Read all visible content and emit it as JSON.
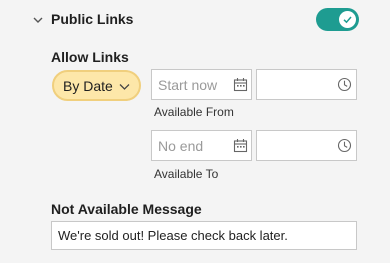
{
  "section": {
    "title": "Public Links",
    "toggle_on": true,
    "toggle_color": "#1e9c91"
  },
  "allow_links": {
    "label": "Allow Links",
    "selected": "By Date",
    "accent": "#fde7a9"
  },
  "available_from": {
    "date_placeholder": "Start now",
    "time_value": "",
    "caption": "Available From"
  },
  "available_to": {
    "date_placeholder": "No end",
    "time_value": "",
    "caption": "Available To"
  },
  "not_available": {
    "label": "Not Available Message",
    "value": "We're sold out! Please check back later."
  },
  "icons": [
    "chevron-down-icon",
    "check-icon",
    "calendar-icon",
    "clock-icon"
  ]
}
